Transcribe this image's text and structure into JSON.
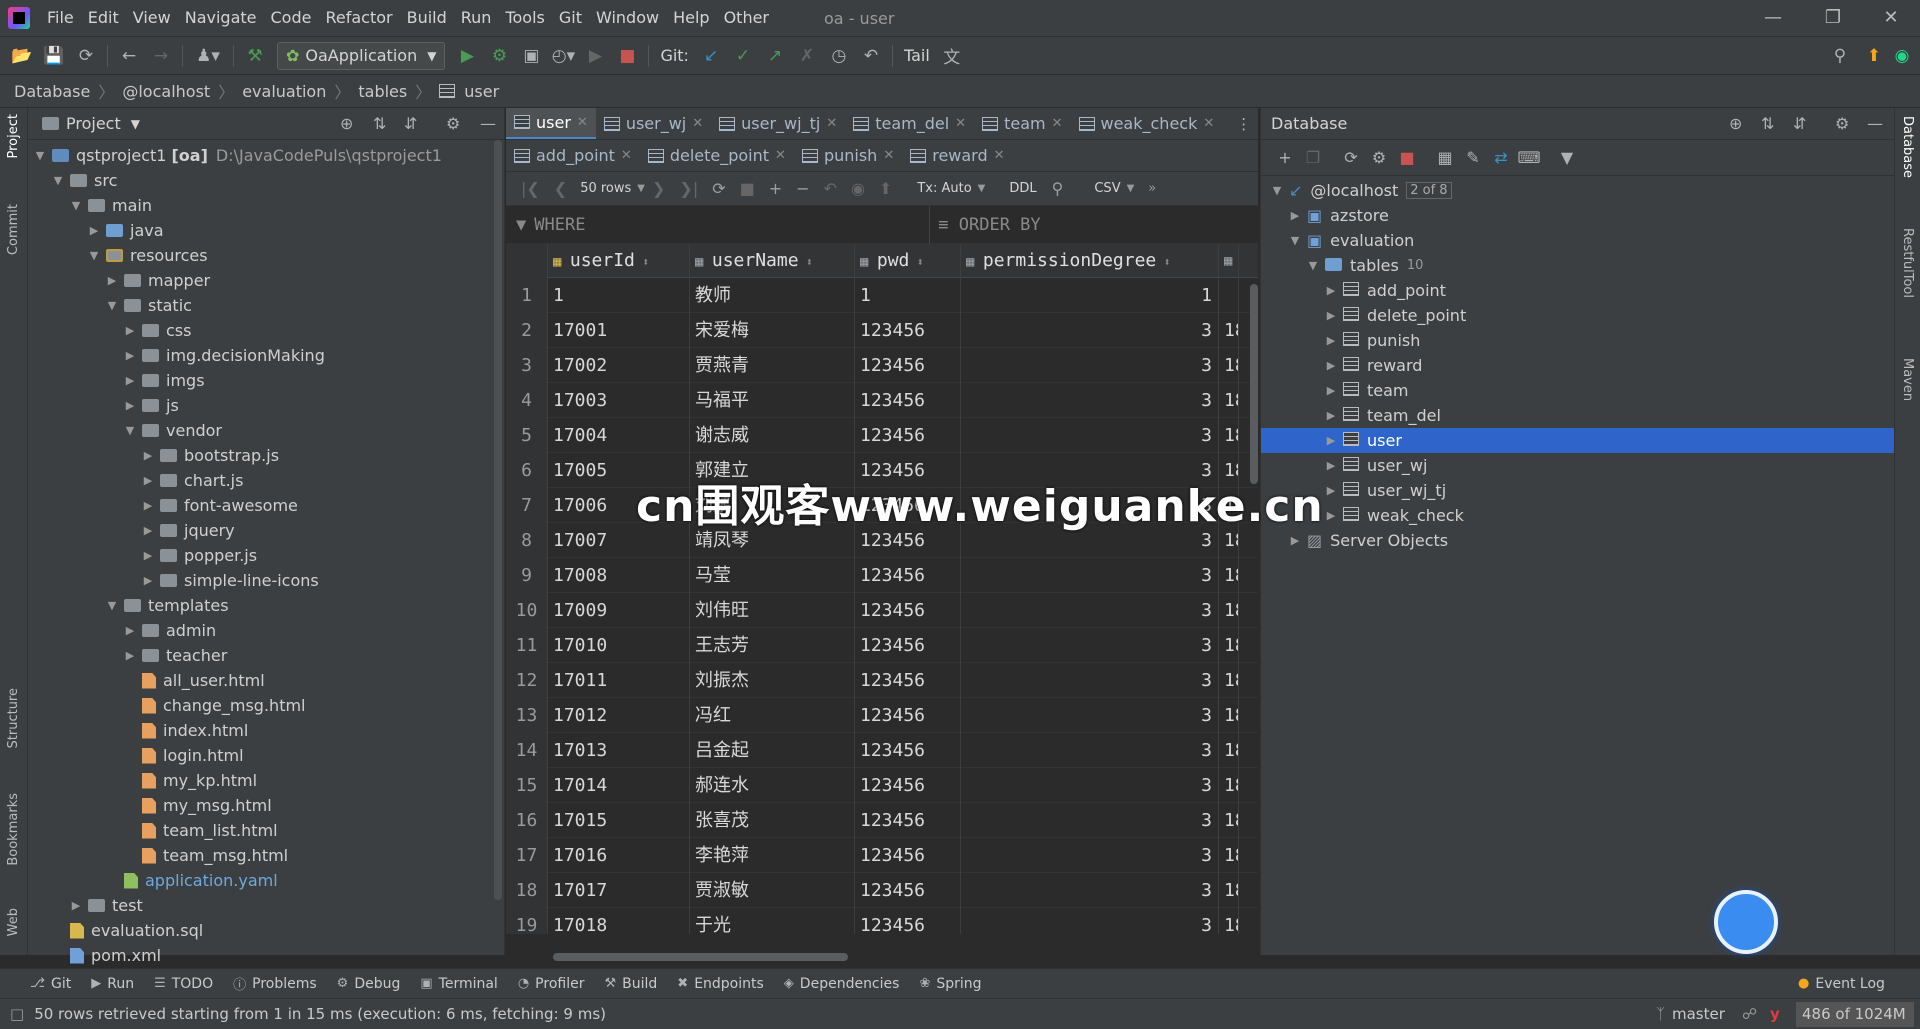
{
  "app": {
    "window_title": "oa - user",
    "menu": [
      "File",
      "Edit",
      "View",
      "Navigate",
      "Code",
      "Refactor",
      "Build",
      "Run",
      "Tools",
      "Git",
      "Window",
      "Help",
      "Other"
    ]
  },
  "toolbar": {
    "run_config": "OaApplication",
    "git_label": "Git:",
    "tail_label": "Tail"
  },
  "breadcrumb": [
    "Database",
    "@localhost",
    "evaluation",
    "tables",
    "user"
  ],
  "left_strip": [
    "Project",
    "Commit",
    "Structure",
    "Bookmarks",
    "Web"
  ],
  "right_strip": [
    "Database",
    "RestfulTool",
    "Maven"
  ],
  "project": {
    "title": "Project",
    "tree": [
      {
        "label": "qstproject1",
        "badge": "[oa]",
        "path": "D:\\JavaCodePuls\\qstproject1",
        "depth": 0,
        "kind": "module",
        "open": true
      },
      {
        "label": "src",
        "depth": 1,
        "kind": "folder",
        "open": true
      },
      {
        "label": "main",
        "depth": 2,
        "kind": "folder",
        "open": true
      },
      {
        "label": "java",
        "depth": 3,
        "kind": "folder-blue",
        "open": false
      },
      {
        "label": "resources",
        "depth": 3,
        "kind": "folder-res",
        "open": true
      },
      {
        "label": "mapper",
        "depth": 4,
        "kind": "folder",
        "open": false
      },
      {
        "label": "static",
        "depth": 4,
        "kind": "folder",
        "open": true
      },
      {
        "label": "css",
        "depth": 5,
        "kind": "folder",
        "open": false
      },
      {
        "label": "img.decisionMaking",
        "depth": 5,
        "kind": "folder",
        "open": false
      },
      {
        "label": "imgs",
        "depth": 5,
        "kind": "folder",
        "open": false
      },
      {
        "label": "js",
        "depth": 5,
        "kind": "folder",
        "open": false
      },
      {
        "label": "vendor",
        "depth": 5,
        "kind": "folder",
        "open": true
      },
      {
        "label": "bootstrap.js",
        "depth": 6,
        "kind": "folder",
        "open": false
      },
      {
        "label": "chart.js",
        "depth": 6,
        "kind": "folder",
        "open": false
      },
      {
        "label": "font-awesome",
        "depth": 6,
        "kind": "folder",
        "open": false
      },
      {
        "label": "jquery",
        "depth": 6,
        "kind": "folder",
        "open": false
      },
      {
        "label": "popper.js",
        "depth": 6,
        "kind": "folder",
        "open": false
      },
      {
        "label": "simple-line-icons",
        "depth": 6,
        "kind": "folder",
        "open": false
      },
      {
        "label": "templates",
        "depth": 4,
        "kind": "folder",
        "open": true
      },
      {
        "label": "admin",
        "depth": 5,
        "kind": "folder",
        "open": false
      },
      {
        "label": "teacher",
        "depth": 5,
        "kind": "folder",
        "open": false
      },
      {
        "label": "all_user.html",
        "depth": 5,
        "kind": "html"
      },
      {
        "label": "change_msg.html",
        "depth": 5,
        "kind": "html"
      },
      {
        "label": "index.html",
        "depth": 5,
        "kind": "html"
      },
      {
        "label": "login.html",
        "depth": 5,
        "kind": "html"
      },
      {
        "label": "my_kp.html",
        "depth": 5,
        "kind": "html"
      },
      {
        "label": "my_msg.html",
        "depth": 5,
        "kind": "html"
      },
      {
        "label": "team_list.html",
        "depth": 5,
        "kind": "html"
      },
      {
        "label": "team_msg.html",
        "depth": 5,
        "kind": "html"
      },
      {
        "label": "application.yaml",
        "depth": 4,
        "kind": "yaml"
      },
      {
        "label": "test",
        "depth": 2,
        "kind": "folder",
        "open": false
      },
      {
        "label": "evaluation.sql",
        "depth": 1,
        "kind": "sql"
      },
      {
        "label": "pom.xml",
        "depth": 1,
        "kind": "xml"
      }
    ]
  },
  "editor": {
    "tabs_row1": [
      {
        "label": "user",
        "active": true
      },
      {
        "label": "user_wj",
        "active": false
      },
      {
        "label": "user_wj_tj",
        "active": false
      },
      {
        "label": "team_del",
        "active": false
      },
      {
        "label": "team",
        "active": false
      },
      {
        "label": "weak_check",
        "active": false
      }
    ],
    "tabs_row2": [
      {
        "label": "add_point",
        "active": false
      },
      {
        "label": "delete_point",
        "active": false
      },
      {
        "label": "punish",
        "active": false
      },
      {
        "label": "reward",
        "active": false
      }
    ],
    "grid_toolbar": {
      "rows": "50 rows",
      "tx": "Tx: Auto",
      "ddl": "DDL",
      "export": "CSV"
    },
    "where_label": "WHERE",
    "orderby_label": "ORDER BY",
    "columns": [
      "userId",
      "userName",
      "pwd",
      "permissionDegree"
    ],
    "rows": [
      [
        "1",
        "1",
        "教师",
        "1",
        "1",
        ""
      ],
      [
        "2",
        "17001",
        "宋爱梅",
        "123456",
        "3",
        "18"
      ],
      [
        "3",
        "17002",
        "贾燕青",
        "123456",
        "3",
        "18"
      ],
      [
        "4",
        "17003",
        "马福平",
        "123456",
        "3",
        "18"
      ],
      [
        "5",
        "17004",
        "谢志威",
        "123456",
        "3",
        "18"
      ],
      [
        "6",
        "17005",
        "郭建立",
        "123456",
        "3",
        "18"
      ],
      [
        "7",
        "17006",
        "刘鹏",
        "123456",
        "3",
        "18"
      ],
      [
        "8",
        "17007",
        "靖凤琴",
        "123456",
        "3",
        "18"
      ],
      [
        "9",
        "17008",
        "马莹",
        "123456",
        "3",
        "18"
      ],
      [
        "10",
        "17009",
        "刘伟旺",
        "123456",
        "3",
        "18"
      ],
      [
        "11",
        "17010",
        "王志芳",
        "123456",
        "3",
        "18"
      ],
      [
        "12",
        "17011",
        "刘振杰",
        "123456",
        "3",
        "18"
      ],
      [
        "13",
        "17012",
        "冯红",
        "123456",
        "3",
        "18"
      ],
      [
        "14",
        "17013",
        "吕金起",
        "123456",
        "3",
        "18"
      ],
      [
        "15",
        "17014",
        "郝连水",
        "123456",
        "3",
        "18"
      ],
      [
        "16",
        "17015",
        "张喜茂",
        "123456",
        "3",
        "18"
      ],
      [
        "17",
        "17016",
        "李艳萍",
        "123456",
        "3",
        "18"
      ],
      [
        "18",
        "17017",
        "贾淑敏",
        "123456",
        "3",
        "18"
      ],
      [
        "19",
        "17018",
        "于光",
        "123456",
        "3",
        "18"
      ]
    ]
  },
  "database": {
    "title": "Database",
    "host": "@localhost",
    "host_badge": "2 of 8",
    "schemas": [
      "azstore",
      "evaluation"
    ],
    "tables_label": "tables",
    "tables_count": "10",
    "tables": [
      "add_point",
      "delete_point",
      "punish",
      "reward",
      "team",
      "team_del",
      "user",
      "user_wj",
      "user_wj_tj",
      "weak_check"
    ],
    "selected_table": "user",
    "server_objects": "Server Objects"
  },
  "watermark": "cn围观客www.weiguanke.cn",
  "bottom_tools": [
    "Git",
    "Run",
    "TODO",
    "Problems",
    "Debug",
    "Terminal",
    "Profiler",
    "Build",
    "Endpoints",
    "Dependencies",
    "Spring"
  ],
  "event_log": "Event Log",
  "status": {
    "message": "50 rows retrieved starting from 1 in 15 ms (execution: 6 ms, fetching: 9 ms)",
    "branch": "master",
    "memory": "486 of 1024M"
  },
  "colors": {
    "accent": "#2f65ca",
    "run_green": "#499c54",
    "stop_red": "#c75450"
  }
}
